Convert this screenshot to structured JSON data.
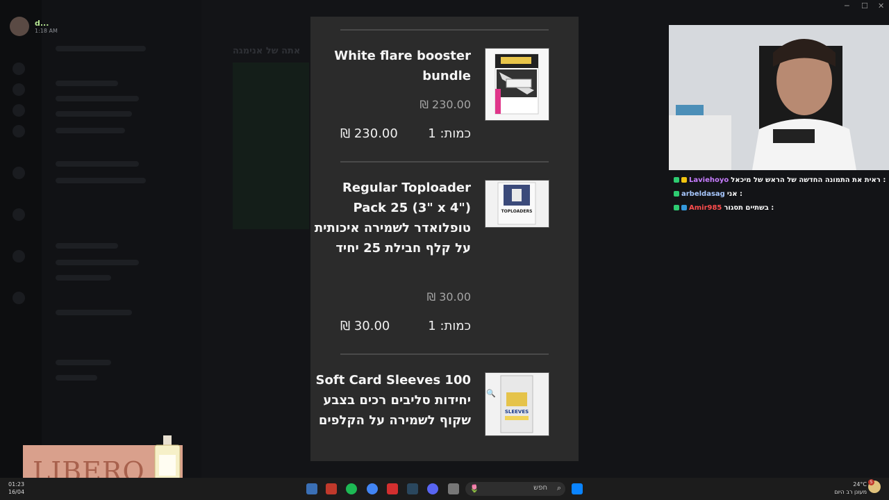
{
  "discord": {
    "user": {
      "name": "d...",
      "time": "1:18 AM"
    },
    "channel_title": "אתה של אנימגה"
  },
  "store_modal": {
    "items": [
      {
        "title": "White flare booster bundle",
        "price": "₪ 230.00",
        "quantity": "כמות: 1",
        "total": "₪ 230.00"
      },
      {
        "title": "Regular Toploader Pack 25 (3\" x 4\") טופלואדר לשמירה איכותית על קלף חבילת 25 יחיד",
        "price": "₪ 30.00",
        "quantity": "כמות: 1",
        "total": "₪ 30.00"
      },
      {
        "title": "Soft Card Sleeves 100 יחידות סליבים רכים בצבע שקוף לשמירה על הקלפים"
      }
    ],
    "thumb_labels": {
      "toploaders": "TOPLOADERS",
      "sleeves": "SLEEVES"
    }
  },
  "chat": {
    "messages": [
      {
        "user": "Laviehoyo",
        "user_color": "#c77dff",
        "text": "ראית את התמונה החדשה של הראש של מיכאל :"
      },
      {
        "user": "arbeldasag",
        "user_color": "#a8c8ff",
        "text": "אני :"
      },
      {
        "user": "Amir985",
        "user_color": "#ff4d4d",
        "text": "בשתיים תסגור :"
      }
    ]
  },
  "taskbar": {
    "clock_time": "01:23",
    "clock_date": "16/04",
    "search_placeholder": "חפש",
    "weather_temp": "24°C",
    "weather_desc": "מעונן רב היום",
    "notification_count": "5"
  },
  "ad": {
    "brand": "LIBERO"
  }
}
